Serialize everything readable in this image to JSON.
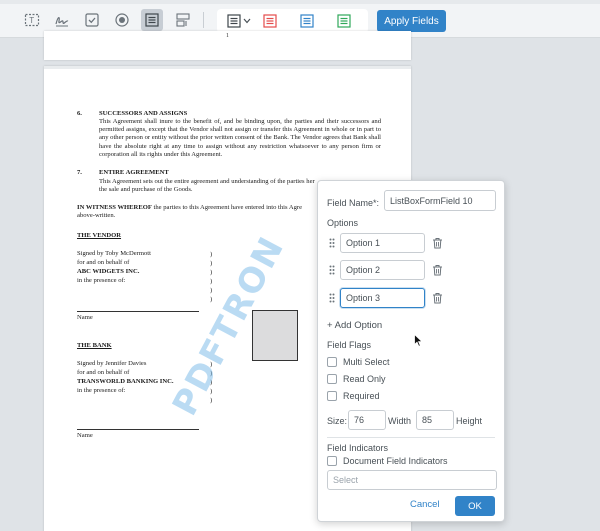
{
  "toolbar": {
    "tools": [
      {
        "name": "text-field-tool",
        "icon": "text-field-icon"
      },
      {
        "name": "signature-field-tool",
        "icon": "signature-icon"
      },
      {
        "name": "checkbox-field-tool",
        "icon": "checkbox-icon"
      },
      {
        "name": "radio-field-tool",
        "icon": "radio-icon"
      },
      {
        "name": "list-box-field-tool",
        "icon": "list-box-icon",
        "active": true
      },
      {
        "name": "combo-box-field-tool",
        "icon": "combo-box-icon"
      }
    ],
    "style_group": {
      "selected": "list-box-icon",
      "swatches": [
        {
          "name": "red-style",
          "color": "#e44b4b"
        },
        {
          "name": "blue-style",
          "color": "#3183c8"
        },
        {
          "name": "green-style",
          "color": "#2fa85a"
        }
      ]
    },
    "apply_label": "Apply Fields"
  },
  "page1": {
    "number": "1"
  },
  "document": {
    "sec6_num": "6.",
    "sec6_title": "SUCCESSORS AND ASSIGNS",
    "sec6_text": "This Agreement shall inure to the benefit of, and be binding upon, the parties and their successors and permitted assigns, except that the Vendor shall not assign or transfer this Agreement in whole or in part to any other person or entity without the prior written consent of the Bank.  The Vendor agrees that Bank shall have the absolute right at any time to assign without any restriction whatsoever to any person firm or corporation all its rights under this Agreement.",
    "sec7_num": "7.",
    "sec7_title": "ENTIRE AGREEMENT",
    "sec7_line1": "This Agreement sets out the entire agreement and understanding of the parties her",
    "sec7_line2": "the sale and purchase of the Goods.",
    "witness_bold": "IN WITNESS WHEREOF",
    "witness_rest": " the parties to this Agreement have entered into this Agre",
    "witness_line2": "above-written.",
    "vendor_heading": "THE VENDOR",
    "vendor_lines": [
      "Signed by Toby McDermott",
      "for and on behalf of",
      "ABC WIDGETS INC.",
      "in the presence of:"
    ],
    "name_label_1": "Name",
    "bank_heading": "THE BANK",
    "bank_lines": [
      "Signed by Jennifer Davies",
      "for and on behalf of",
      "TRANSWORLD BANKING INC.",
      "in the presence of:"
    ],
    "name_label_2": "Name",
    "paren": ")",
    "watermark": "PDFTRON"
  },
  "popup": {
    "field_name_label": "Field Name*:",
    "field_name_value": "ListBoxFormField 10",
    "options_label": "Options",
    "options": [
      "Option 1",
      "Option 2",
      "Option 3"
    ],
    "add_option_label": "+ Add Option",
    "flags_label": "Field Flags",
    "flags": [
      "Multi Select",
      "Read Only",
      "Required"
    ],
    "size_label": "Size:",
    "width_value": "76",
    "width_label": "Width",
    "height_value": "85",
    "height_label": "Height",
    "indicators_label": "Field Indicators",
    "doc_indicators_label": "Document Field Indicators",
    "select_placeholder": "Select",
    "cancel_label": "Cancel",
    "ok_label": "OK"
  }
}
